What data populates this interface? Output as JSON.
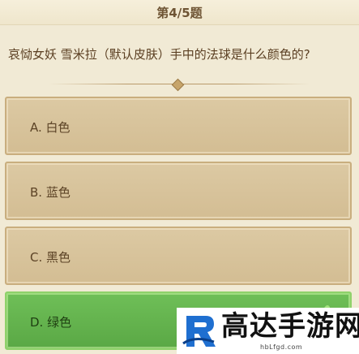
{
  "header": {
    "progress": "第4/5题"
  },
  "question": {
    "text": "哀恸女妖 雪米拉（默认皮肤）手中的法球是什么颜色的?"
  },
  "options": [
    {
      "label": "A. 白色",
      "state": "default"
    },
    {
      "label": "B. 蓝色",
      "state": "default"
    },
    {
      "label": "C. 黑色",
      "state": "default"
    },
    {
      "label": "D. 绿色",
      "state": "correct"
    }
  ],
  "colors": {
    "background": "#f1ead5",
    "option_default": "#d8c39b",
    "option_correct": "#66b650",
    "text": "#5b3f22"
  },
  "watermark": {
    "title": "高达手游网",
    "url": "hbLfgd.com"
  }
}
